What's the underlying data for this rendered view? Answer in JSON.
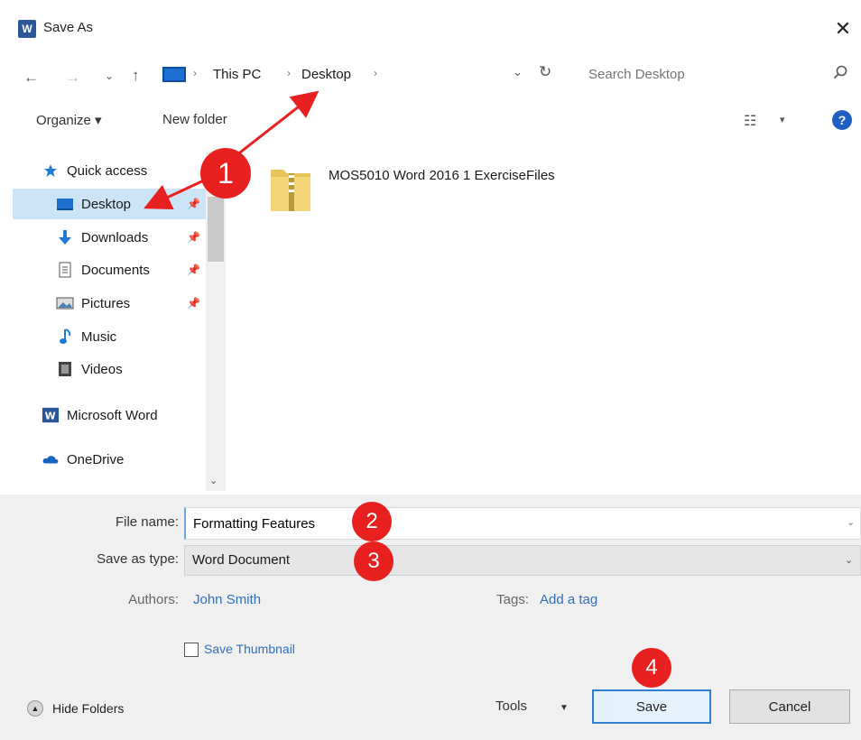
{
  "window": {
    "title": "Save As",
    "close_glyph": "✕"
  },
  "nav": {
    "back_glyph": "←",
    "forward_glyph": "→",
    "recent_glyph": "⌄",
    "up_glyph": "↑",
    "breadcrumb": [
      "This PC",
      "Desktop"
    ],
    "sep_glyph": "›",
    "search_placeholder": "Search Desktop"
  },
  "toolbar": {
    "organize": "Organize ▾",
    "new_folder": "New folder",
    "view_glyph": "☷",
    "help_glyph": "?"
  },
  "sidebar": {
    "quick_access": "Quick access",
    "items": [
      {
        "label": "Desktop",
        "icon": "desktop-icon",
        "pinned": true,
        "selected": true
      },
      {
        "label": "Downloads",
        "icon": "download-icon",
        "pinned": true
      },
      {
        "label": "Documents",
        "icon": "documents-icon",
        "pinned": true
      },
      {
        "label": "Pictures",
        "icon": "pictures-icon",
        "pinned": true
      },
      {
        "label": "Music",
        "icon": "music-icon"
      },
      {
        "label": "Videos",
        "icon": "videos-icon"
      }
    ],
    "word": "Microsoft Word",
    "onedrive": "OneDrive"
  },
  "files": [
    {
      "name": "MOS5010 Word 2016 1 ExerciseFiles"
    }
  ],
  "form": {
    "file_name_label": "File name:",
    "file_name_value": "Formatting Features",
    "type_label": "Save as type:",
    "type_value": "Word Document",
    "authors_label": "Authors:",
    "authors_value": "John Smith",
    "tags_label": "Tags:",
    "tags_value": "Add a tag",
    "thumbnail_label": "Save Thumbnail"
  },
  "footer": {
    "hide_folders": "Hide Folders",
    "tools": "Tools",
    "save": "Save",
    "cancel": "Cancel"
  },
  "annotations": {
    "b1": "1",
    "b2": "2",
    "b3": "3",
    "b4": "4"
  },
  "colors": {
    "accent": "#2d7fd4",
    "annotation": "#e8201f",
    "selected": "#cce4f7"
  }
}
